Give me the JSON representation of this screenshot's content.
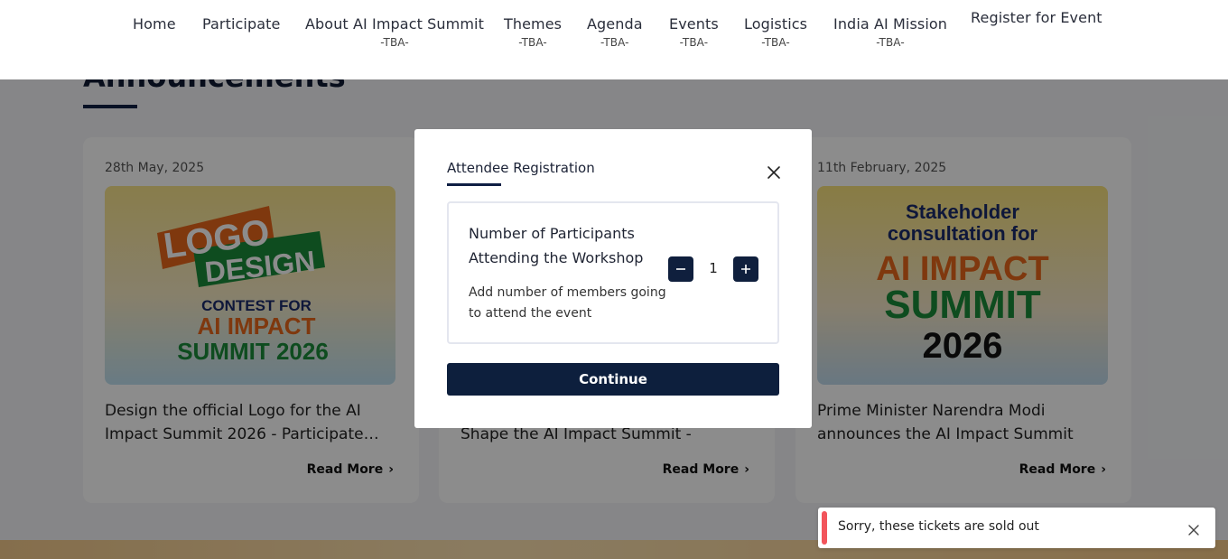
{
  "nav": {
    "items": [
      {
        "label": "Home",
        "sub": ""
      },
      {
        "label": "Participate",
        "sub": ""
      },
      {
        "label": "About AI Impact Summit",
        "sub": "-TBA-"
      },
      {
        "label": "Themes",
        "sub": "-TBA-"
      },
      {
        "label": "Agenda",
        "sub": "-TBA-"
      },
      {
        "label": "Events",
        "sub": "-TBA-"
      },
      {
        "label": "Logistics",
        "sub": "-TBA-"
      },
      {
        "label": "India AI Mission",
        "sub": "-TBA-"
      },
      {
        "label": "Register for Event",
        "sub": ""
      }
    ]
  },
  "section": {
    "heading": "Announcements"
  },
  "cards": [
    {
      "date": "28th May, 2025",
      "image_lines": [
        "LOGO",
        "DESIGN",
        "CONTEST FOR",
        "AI IMPACT",
        "SUMMIT 2026"
      ],
      "text": "Design the official Logo for the AI Impact Summit 2026 - Participate…",
      "read_more": "Read More"
    },
    {
      "date": "",
      "image_lines": [],
      "text": "Shape the AI Impact Summit - Subm…",
      "read_more": "Read More"
    },
    {
      "date": "11th February, 2025",
      "image_lines": [
        "Stakeholder",
        "consultation for",
        "AI IMPACT",
        "SUMMIT",
        "2026"
      ],
      "text": "Prime Minister Narendra Modi announces the AI Impact Summit to…",
      "read_more": "Read More"
    }
  ],
  "modal": {
    "title": "Attendee Registration",
    "field_label": "Number of Participants Attending the Workshop",
    "field_help": "Add number of members going to attend the event",
    "quantity": "1",
    "continue_label": "Continue"
  },
  "toast": {
    "message": "Sorry, these tickets are sold out"
  },
  "colors": {
    "primary_navy": "#0d1f3d",
    "toast_accent": "#f2545b",
    "logo_orange": "#e8661a",
    "logo_green": "#1a8a3a",
    "logo_navy": "#1b2a6b"
  }
}
